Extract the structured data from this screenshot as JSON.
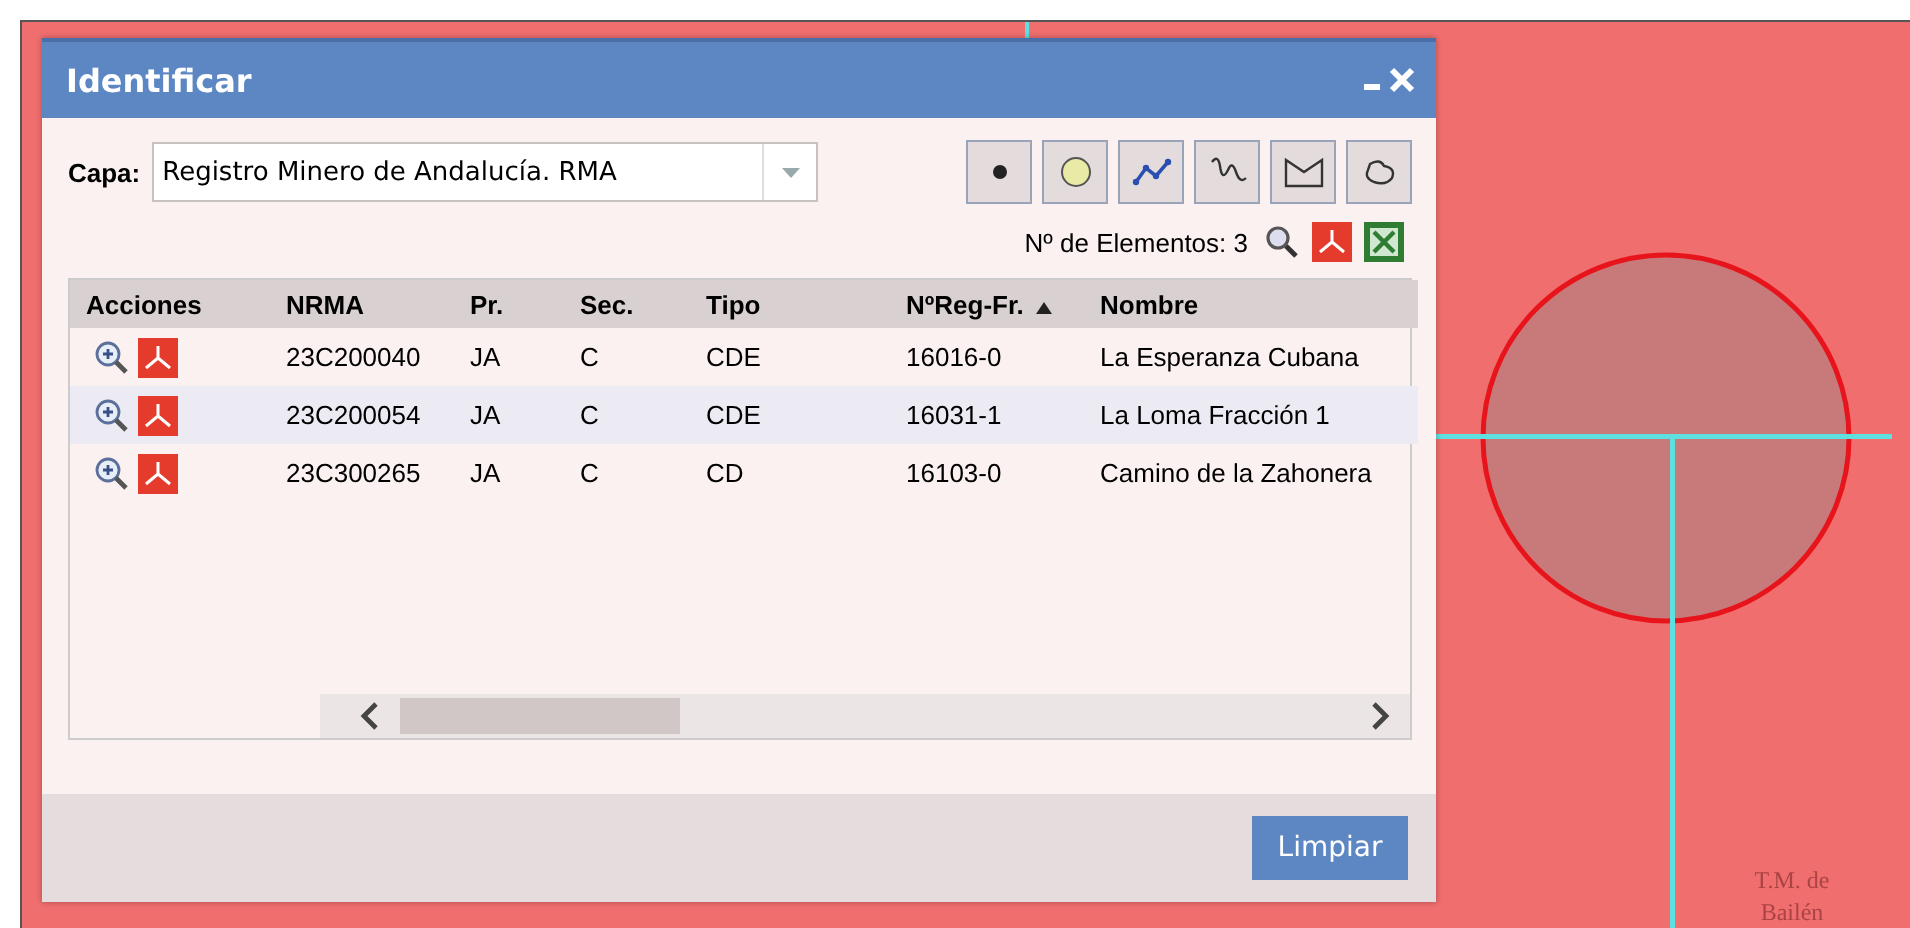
{
  "map": {
    "labels": [
      "T.M. de Bailén"
    ]
  },
  "dialog": {
    "title": "Identificar",
    "layer": {
      "label": "Capa:",
      "value": "Registro Minero de Andalucía. RMA"
    },
    "tools": [
      {
        "kind": "point"
      },
      {
        "kind": "circle"
      },
      {
        "kind": "line"
      },
      {
        "kind": "freehand"
      },
      {
        "kind": "polygon"
      },
      {
        "kind": "freeshape"
      }
    ],
    "count": "Nº de Elementos: 3",
    "table": {
      "columns": [
        {
          "label": "Acciones",
          "sorted": false
        },
        {
          "label": "NRMA",
          "sorted": false
        },
        {
          "label": "Pr.",
          "sorted": false
        },
        {
          "label": "Sec.",
          "sorted": false
        },
        {
          "label": "Tipo",
          "sorted": false
        },
        {
          "label": "NºReg-Fr.",
          "sorted": true
        },
        {
          "label": "Nombre",
          "sorted": false
        }
      ],
      "rows": [
        {
          "selected": false,
          "cells": [
            "",
            "23C200040",
            "JA",
            "C",
            "CDE",
            "16016-0",
            "La Esperanza Cubana"
          ]
        },
        {
          "selected": true,
          "cells": [
            "",
            "23C200054",
            "JA",
            "C",
            "CDE",
            "16031-1",
            "La Loma Fracción 1"
          ]
        },
        {
          "selected": false,
          "cells": [
            "",
            "23C300265",
            "JA",
            "C",
            "CD",
            "16103-0",
            "Camino de la Zahonera"
          ]
        }
      ]
    },
    "buttons": [
      "Limpiar"
    ]
  }
}
